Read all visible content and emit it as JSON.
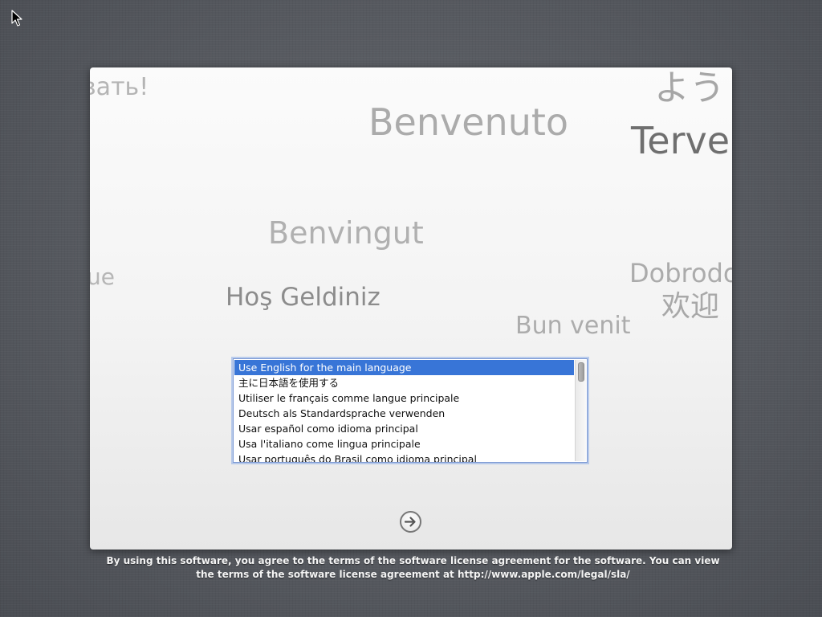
{
  "welcome_words": {
    "russian_fragment": "вать!",
    "italian": "Benvenuto",
    "japanese_fragment": "よう",
    "finnish_fragment": "Terve",
    "catalan": "Benvingut",
    "fragment_left": "ue",
    "turkish": "Hoş Geldiniz",
    "croatian_fragment": "Dobrodo",
    "chinese": "欢迎",
    "romanian": "Bun venit"
  },
  "language_list": {
    "items": [
      {
        "label": "Use English for the main language",
        "selected": true
      },
      {
        "label": "主に日本語を使用する",
        "selected": false
      },
      {
        "label": "Utiliser le français comme langue principale",
        "selected": false
      },
      {
        "label": "Deutsch als Standardsprache verwenden",
        "selected": false
      },
      {
        "label": "Usar español como idioma principal",
        "selected": false
      },
      {
        "label": "Usa l'italiano come lingua principale",
        "selected": false
      },
      {
        "label": "Usar português do Brasil como idioma principal",
        "selected": false
      }
    ]
  },
  "next_button": {
    "icon": "arrow-right-circle-icon"
  },
  "license": {
    "line1": "By using this software, you agree to the terms of the software license agreement for the software. You can view",
    "line2": "the terms of the software license agreement at http://www.apple.com/legal/sla/"
  },
  "colors": {
    "selection": "#3875d7",
    "list_focus_ring": "#7d9ad4",
    "background": "#5a5d63"
  }
}
